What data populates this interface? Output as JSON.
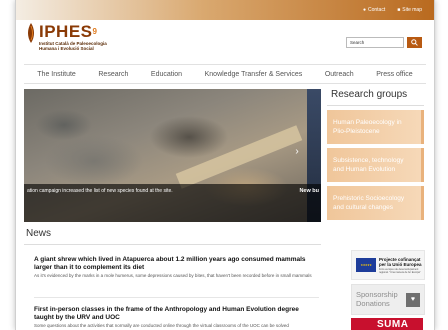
{
  "topbar": {
    "contact_label": "Contact",
    "sitemap_label": "Site map"
  },
  "brand": {
    "name": "IPHES",
    "superscript": "9",
    "subtitle_line1": "Institut Català de Paleoecologia",
    "subtitle_line2": "Humana i Evolució Social",
    "color": "#8a3a06"
  },
  "search": {
    "placeholder": "Search",
    "button_icon": "search-icon"
  },
  "nav": {
    "items": [
      {
        "label": "The Institute"
      },
      {
        "label": "Research"
      },
      {
        "label": "Education"
      },
      {
        "label": "Knowledge Transfer & Services"
      },
      {
        "label": "Outreach"
      },
      {
        "label": "Press office"
      }
    ]
  },
  "hero": {
    "caption": "ation campaign increased the list of new species found at the site.",
    "next_caption": "New bu"
  },
  "research_groups": {
    "title": "Research groups",
    "items": [
      {
        "label_line1": "Human Paleoecology in",
        "label_line2": "Plio-Pleistocene"
      },
      {
        "label_line1": "Subsistence, technology",
        "label_line2": "and Human Evolution"
      },
      {
        "label_line1": "Prehistoric Socioecology",
        "label_line2": "and cultural changes"
      }
    ]
  },
  "news": {
    "title": "News",
    "items": [
      {
        "headline": "A giant shrew which lived in Atapuerca about 1.2 million years ago consumed mammals larger than it to complement its diet",
        "summary": "As it's evidenced by the marks in a mole humerus, some depressions caused by bites, that haven't been recorded before in small mammals"
      },
      {
        "headline": "First in-person classes in the frame of the Anthropology and Human Evolution degree taught by the URV and UOC",
        "summary": "Some questions about the activities that normally are conducted online through the virtual classrooms of the UOC can be solved"
      }
    ]
  },
  "sidebar": {
    "eu_line1": "Projecte cofinançat",
    "eu_line2": "per la Unió Europea",
    "eu_small": "Fons europeu de desenvolupament regional. \"Una manera de fer Europa\"",
    "sponsor_line1": "Sponsorship",
    "sponsor_line2": "Donations",
    "sponsor_icon": "donation-icon",
    "banner_text": "SUMA"
  },
  "colors": {
    "accent": "#b85a12",
    "research_group_bg": "#f0c69a",
    "banner_red": "#c8102e"
  }
}
